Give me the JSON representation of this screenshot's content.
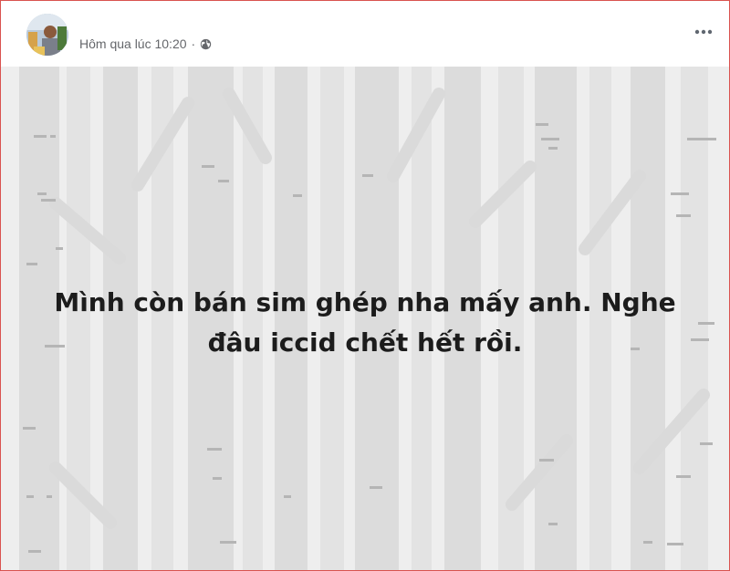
{
  "post": {
    "timestamp": "Hôm qua lúc 10:20",
    "separator": "·",
    "privacy_icon": "globe-icon",
    "more_icon": "more-horizontal-icon",
    "avatar_icon": "profile-avatar",
    "text_lines": [
      "Mình còn bán sim ghép nha mấy anh. Nghe",
      "đâu iccid chết hết rồi."
    ],
    "background_pattern": "birch-forest",
    "colors": {
      "background": "#eeeeee",
      "trees": "#d8d8d8",
      "text": "#1c1c1c",
      "meta_text": "#65676b"
    }
  }
}
